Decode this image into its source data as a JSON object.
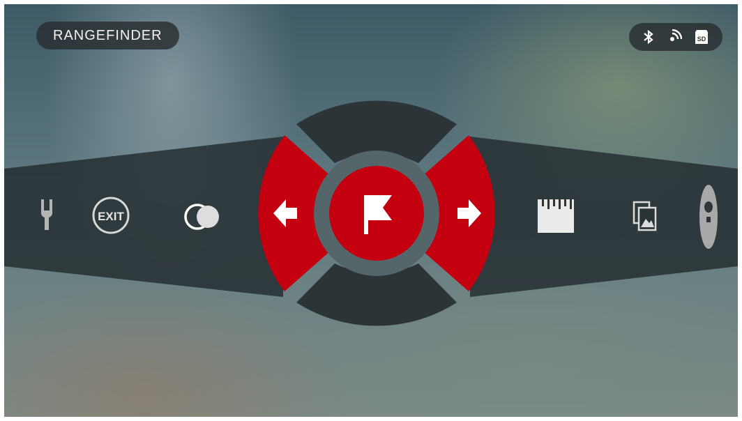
{
  "header": {
    "mode_label": "RANGEFINDER"
  },
  "status_icons": [
    "bluetooth-icon",
    "wifi-icon",
    "sd-card-icon"
  ],
  "menu": {
    "left_items": [
      "tuning-fork-icon",
      "exit-icon",
      "dual-circle-icon"
    ],
    "right_items": [
      "ruler-icon",
      "gallery-icon",
      "mic-icon"
    ],
    "center": "flag-icon",
    "exit_label": "EXIT",
    "sd_label": "SD"
  },
  "colors": {
    "accent": "#c40010",
    "ring": "#55666a",
    "band": "#2a3336"
  }
}
